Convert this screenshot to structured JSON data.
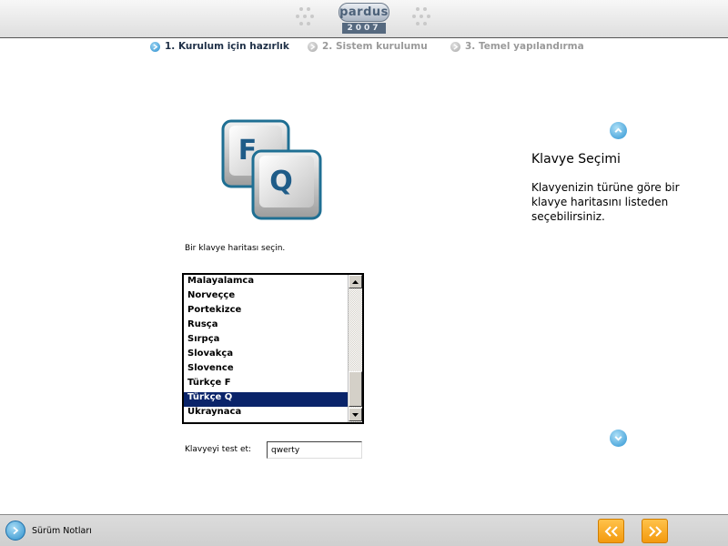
{
  "brand": {
    "name": "pardus",
    "year": "2007"
  },
  "steps": [
    {
      "label": "1. Kurulum için hazırlık",
      "state": "active"
    },
    {
      "label": "2. Sistem kurulumu",
      "state": "inactive"
    },
    {
      "label": "3. Temel yapılandırma",
      "state": "inactive"
    }
  ],
  "keyboard_icon": {
    "keys": [
      "F",
      "Q"
    ],
    "icon": "keyboard-keys-icon"
  },
  "layout_prompt": "Bir klavye haritası seçin.",
  "layouts": {
    "items": [
      "Malayalamca",
      "Norveççe",
      "Portekizce",
      "Rusça",
      "Sırpça",
      "Slovakça",
      "Slovence",
      "Türkçe F",
      "Türkçe Q",
      "Ukraynaca"
    ],
    "selected": "Türkçe Q"
  },
  "test": {
    "label": "Klavyeyi test et:",
    "value": "qwerty"
  },
  "help": {
    "title": "Klavye Seçimi",
    "text": "Klavyenizin türüne göre bir klavye haritasını listeden seçebilirsiniz."
  },
  "footer": {
    "release_notes_label": "Sürüm Notları"
  },
  "colors": {
    "accent": "#2a8fcf",
    "selection": "#0a246a",
    "nav_button": "#f7a51c"
  }
}
